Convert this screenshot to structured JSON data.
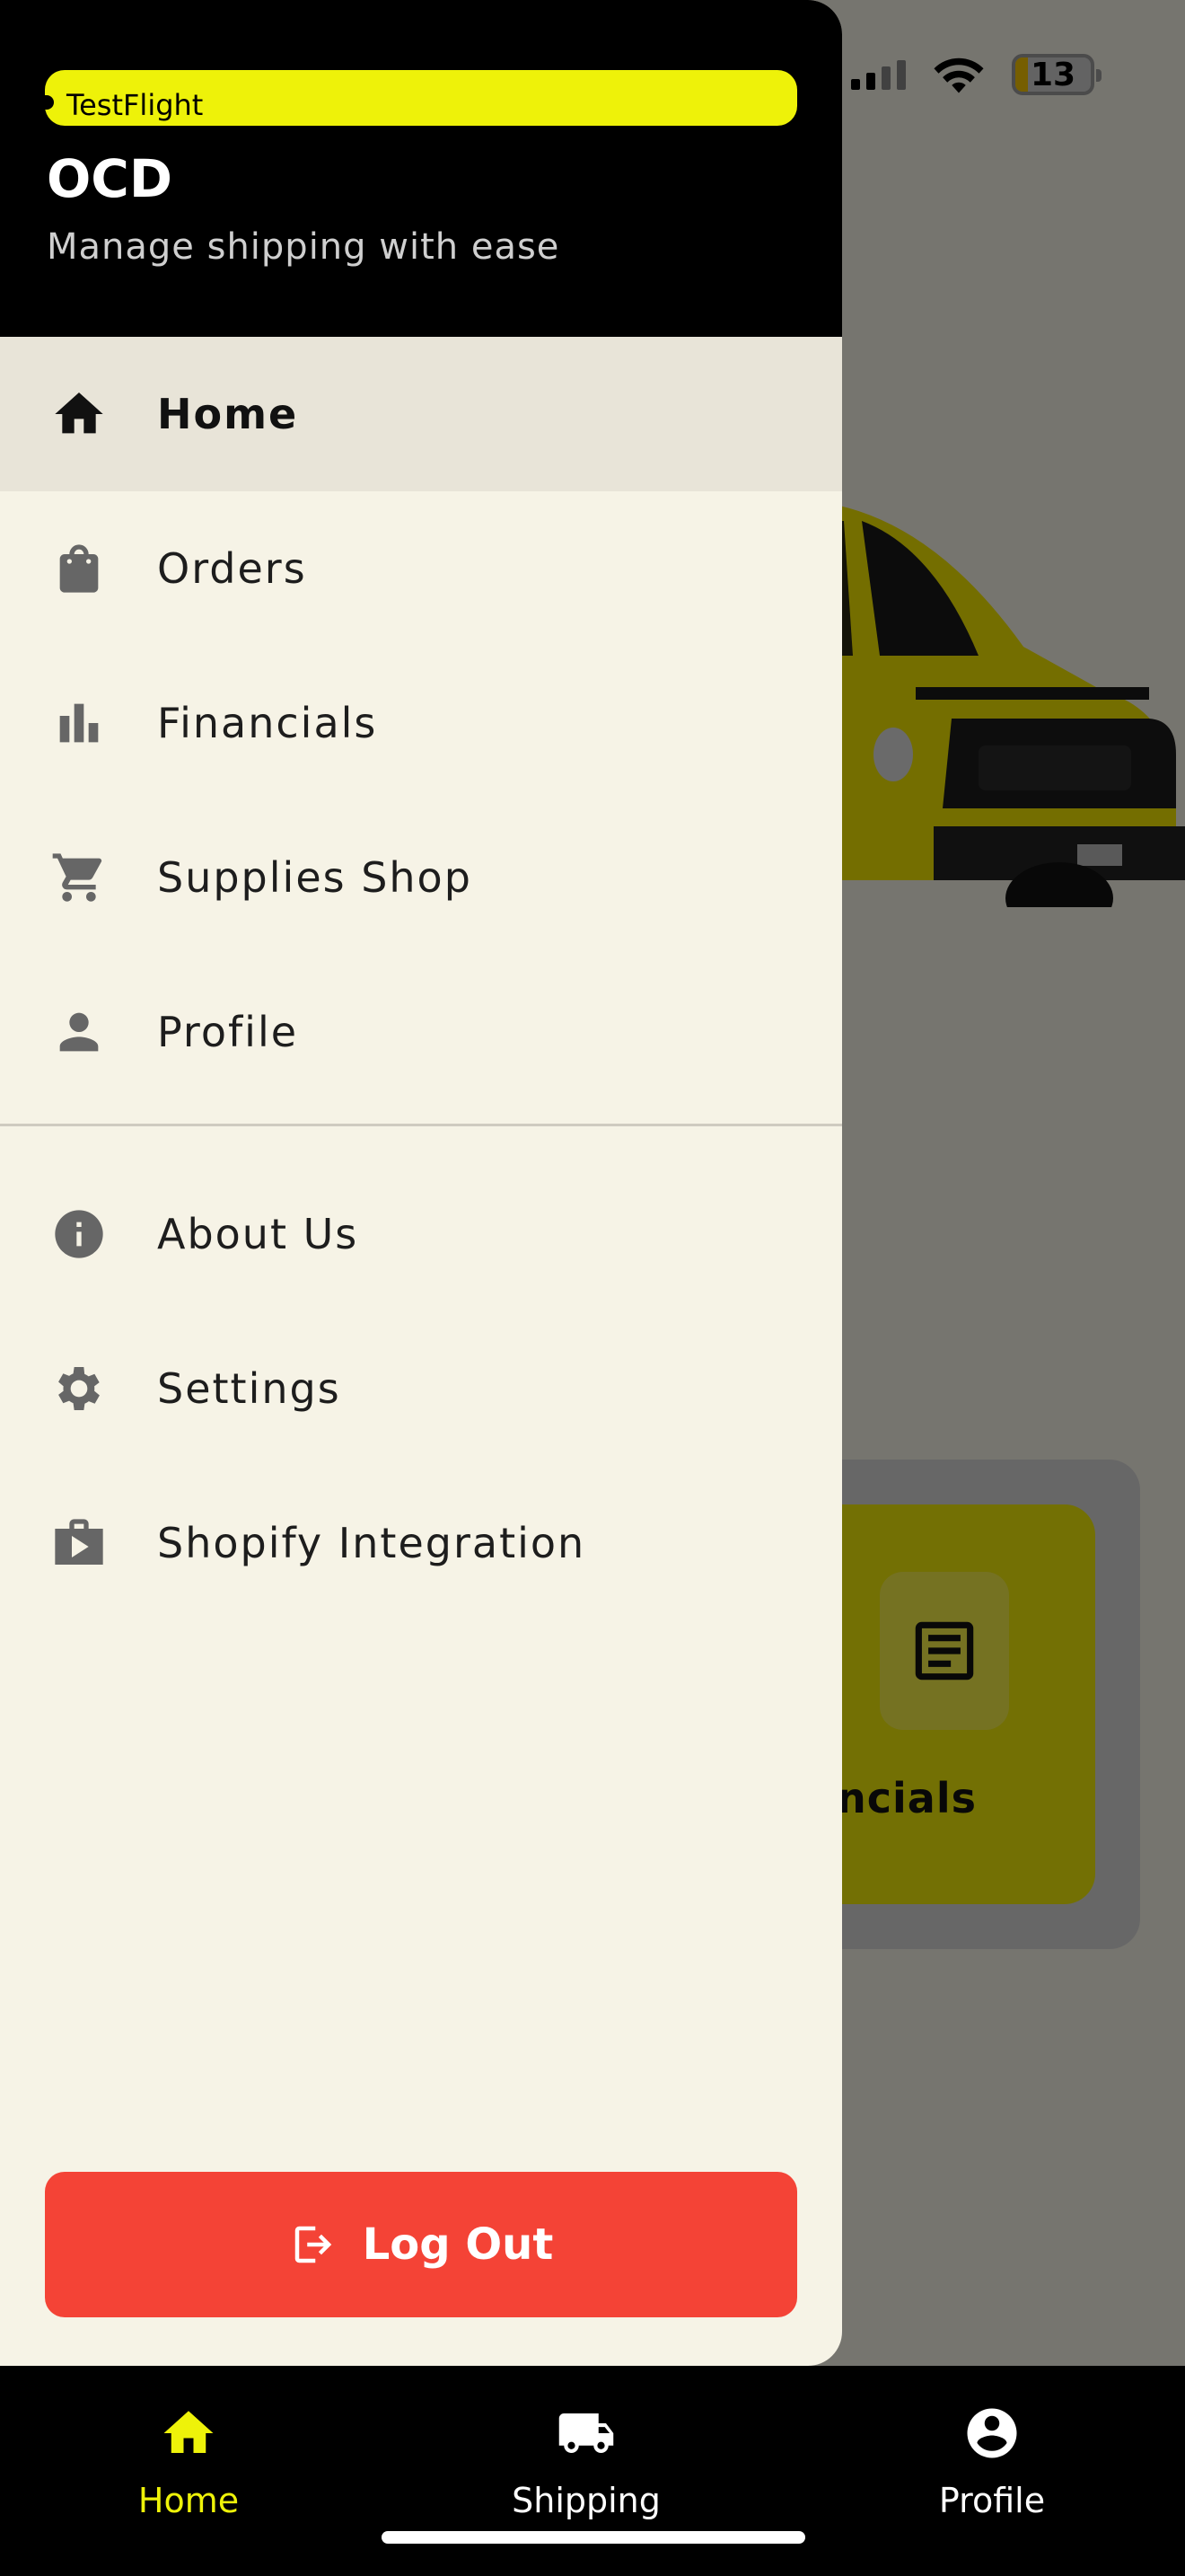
{
  "status_bar": {
    "battery": "13",
    "icons": [
      "cellular-signal-icon",
      "wifi-icon",
      "battery-icon"
    ]
  },
  "background": {
    "card_label": "ncials",
    "colors": {
      "accent": "#eef209",
      "surface": "#f7f4e8"
    }
  },
  "drawer": {
    "testflight_label": "TestFlight",
    "title": "OCD",
    "subtitle": "Manage shipping with ease",
    "primary_items": [
      {
        "label": "Home",
        "icon": "home-icon",
        "active": true
      },
      {
        "label": "Orders",
        "icon": "shopping-bag-icon",
        "active": false
      },
      {
        "label": "Financials",
        "icon": "bar-chart-icon",
        "active": false
      },
      {
        "label": "Supplies Shop",
        "icon": "cart-icon",
        "active": false
      },
      {
        "label": "Profile",
        "icon": "person-icon",
        "active": false
      }
    ],
    "secondary_items": [
      {
        "label": "About Us",
        "icon": "info-icon"
      },
      {
        "label": "Settings",
        "icon": "gear-icon"
      },
      {
        "label": "Shopify Integration",
        "icon": "shop-play-icon"
      }
    ],
    "logout_label": "Log Out",
    "colors": {
      "header": "#000000",
      "panel": "#f6f3e6",
      "active_row": "#e8e4d8",
      "logout": "#f44336",
      "testflight": "#eef209"
    }
  },
  "bottom_nav": {
    "items": [
      {
        "label": "Home",
        "icon": "home-icon",
        "active": true
      },
      {
        "label": "Shipping",
        "icon": "truck-icon",
        "active": false
      },
      {
        "label": "Profile",
        "icon": "account-circle-icon",
        "active": false
      }
    ],
    "colors": {
      "active": "#eef209",
      "inactive": "#ffffff",
      "background": "#000000"
    }
  }
}
